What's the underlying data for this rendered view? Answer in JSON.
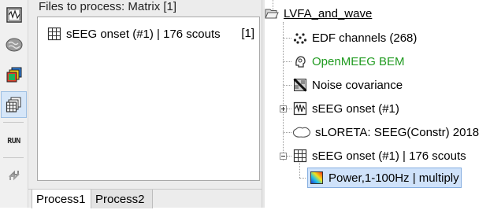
{
  "toolbar": {
    "buttons": [
      {
        "name": "raw-file-icon",
        "active": false
      },
      {
        "name": "brain-icon",
        "active": false
      },
      {
        "name": "source-maps-icon",
        "active": false
      },
      {
        "name": "matrix-icon",
        "active": true
      },
      {
        "name": "run-icon",
        "label": "RUN"
      },
      {
        "name": "reload-icon",
        "active": false
      }
    ]
  },
  "process_panel": {
    "files_title": "Files to process: Matrix [1]",
    "files": [
      {
        "icon": "matrix-icon",
        "label": "sEEG onset (#1) | 176 scouts",
        "count": "[1]"
      }
    ],
    "tabs": [
      {
        "label": "Process1",
        "selected": true
      },
      {
        "label": "Process2",
        "selected": false
      }
    ]
  },
  "tree": {
    "root": {
      "icon": "folder-open-icon",
      "label": "LVFA_and_wave"
    },
    "items": [
      {
        "icon": "channels-icon",
        "label": "EDF channels (268)"
      },
      {
        "icon": "head-model-icon",
        "label": "OpenMEEG BEM",
        "color": "#1f9a1f"
      },
      {
        "icon": "noise-covariance-icon",
        "label": "Noise covariance"
      },
      {
        "icon": "recording-icon",
        "label": "sEEG onset (#1)",
        "expander": "plus"
      },
      {
        "icon": "brain-outline-icon",
        "label": "sLORETA: SEEG(Constr) 2018"
      },
      {
        "icon": "matrix-icon",
        "label": "sEEG onset (#1) | 176 scouts",
        "expander": "minus"
      },
      {
        "icon": "timefreq-icon",
        "label": "Power,1-100Hz | multiply",
        "selected": true
      }
    ]
  }
}
